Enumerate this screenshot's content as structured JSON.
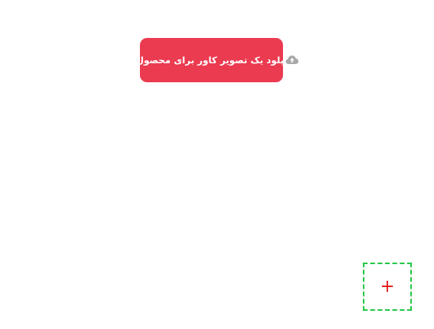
{
  "upload": {
    "button_label": "آپلود یک تصویر کاور برای محصول",
    "icon": "cloud-upload-icon"
  },
  "add_tile": {
    "symbol": "+",
    "icon": "plus-icon"
  },
  "colors": {
    "button_bg": "#eb3b51",
    "button_text": "#ffffff",
    "cloud_icon": "#a9a9a9",
    "tile_border": "#27c84a",
    "plus": "#e21b1b"
  }
}
